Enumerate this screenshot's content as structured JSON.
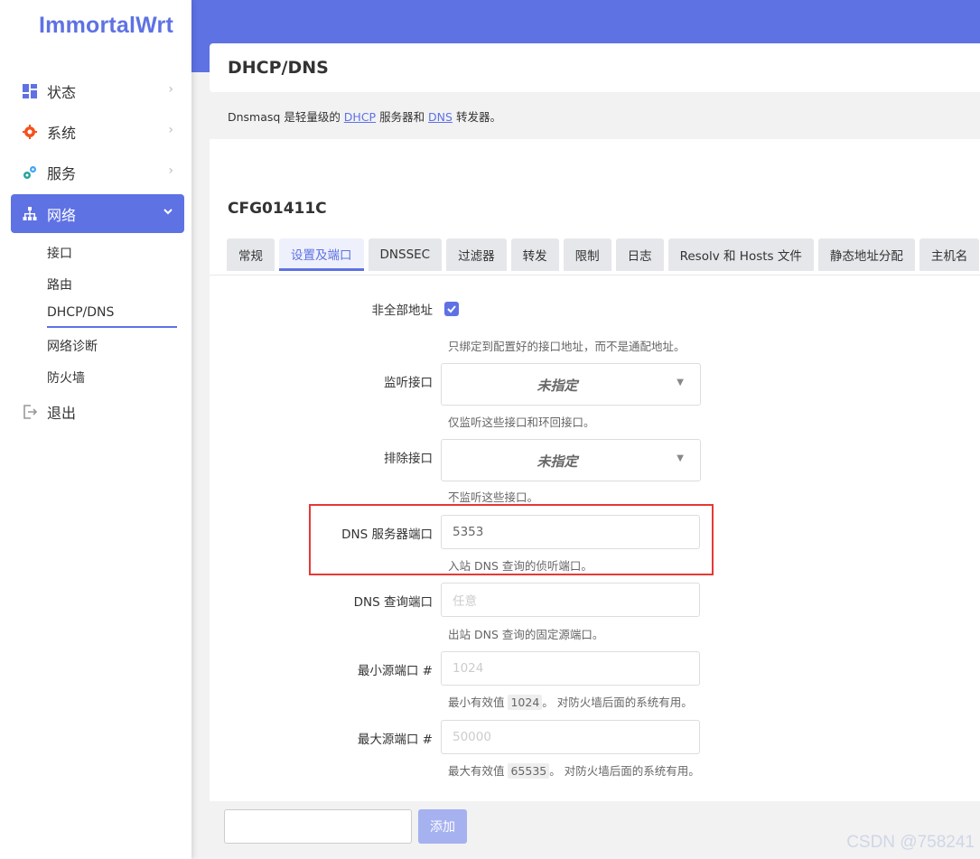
{
  "brand": "ImmortalWrt",
  "sidebar": {
    "items": [
      {
        "label": "状态",
        "icon": "dashboard-icon",
        "chevron": "›"
      },
      {
        "label": "系统",
        "icon": "gear-icon",
        "chevron": "›"
      },
      {
        "label": "服务",
        "icon": "services-icon",
        "chevron": "›"
      },
      {
        "label": "网络",
        "icon": "network-icon",
        "chevron": "⌄",
        "active": true
      }
    ],
    "subitems": [
      "接口",
      "路由",
      "DHCP/DNS",
      "网络诊断",
      "防火墙"
    ],
    "active_subitem": "DHCP/DNS",
    "logout": "退出"
  },
  "page": {
    "title": "DHCP/DNS",
    "desc_prefix": "Dnsmasq 是轻量级的 ",
    "desc_link1": "DHCP",
    "desc_middle": " 服务器和 ",
    "desc_link2": "DNS",
    "desc_suffix": " 转发器。",
    "section_title": "CFG01411C"
  },
  "tabs": [
    "常规",
    "设置及端口",
    "DNSSEC",
    "过滤器",
    "转发",
    "限制",
    "日志",
    "Resolv 和 Hosts 文件",
    "静态地址分配",
    "主机名"
  ],
  "active_tab": "设置及端口",
  "form": {
    "nonwildcard": {
      "label": "非全部地址",
      "checked": true,
      "hint": "只绑定到配置好的接口地址，而不是通配地址。"
    },
    "listen_iface": {
      "label": "监听接口",
      "value": "未指定",
      "hint": "仅监听这些接口和环回接口。"
    },
    "exclude_iface": {
      "label": "排除接口",
      "value": "未指定",
      "hint": "不监听这些接口。"
    },
    "dns_port": {
      "label": "DNS 服务器端口",
      "value": "5353",
      "hint": "入站 DNS 查询的侦听端口。"
    },
    "query_port": {
      "label": "DNS 查询端口",
      "placeholder": "任意",
      "hint": "出站 DNS 查询的固定源端口。"
    },
    "min_port": {
      "label": "最小源端口 #",
      "placeholder": "1024",
      "hint_prefix": "最小有效值 ",
      "hint_code": "1024",
      "hint_suffix": "。 对防火墙后面的系统有用。"
    },
    "max_port": {
      "label": "最大源端口 #",
      "placeholder": "50000",
      "hint_prefix": "最大有效值 ",
      "hint_code": "65535",
      "hint_suffix": "。 对防火墙后面的系统有用。"
    }
  },
  "add_button": "添加",
  "watermark": "CSDN @758241",
  "colors": {
    "accent": "#5e72e4",
    "highlight": "#e53935"
  }
}
